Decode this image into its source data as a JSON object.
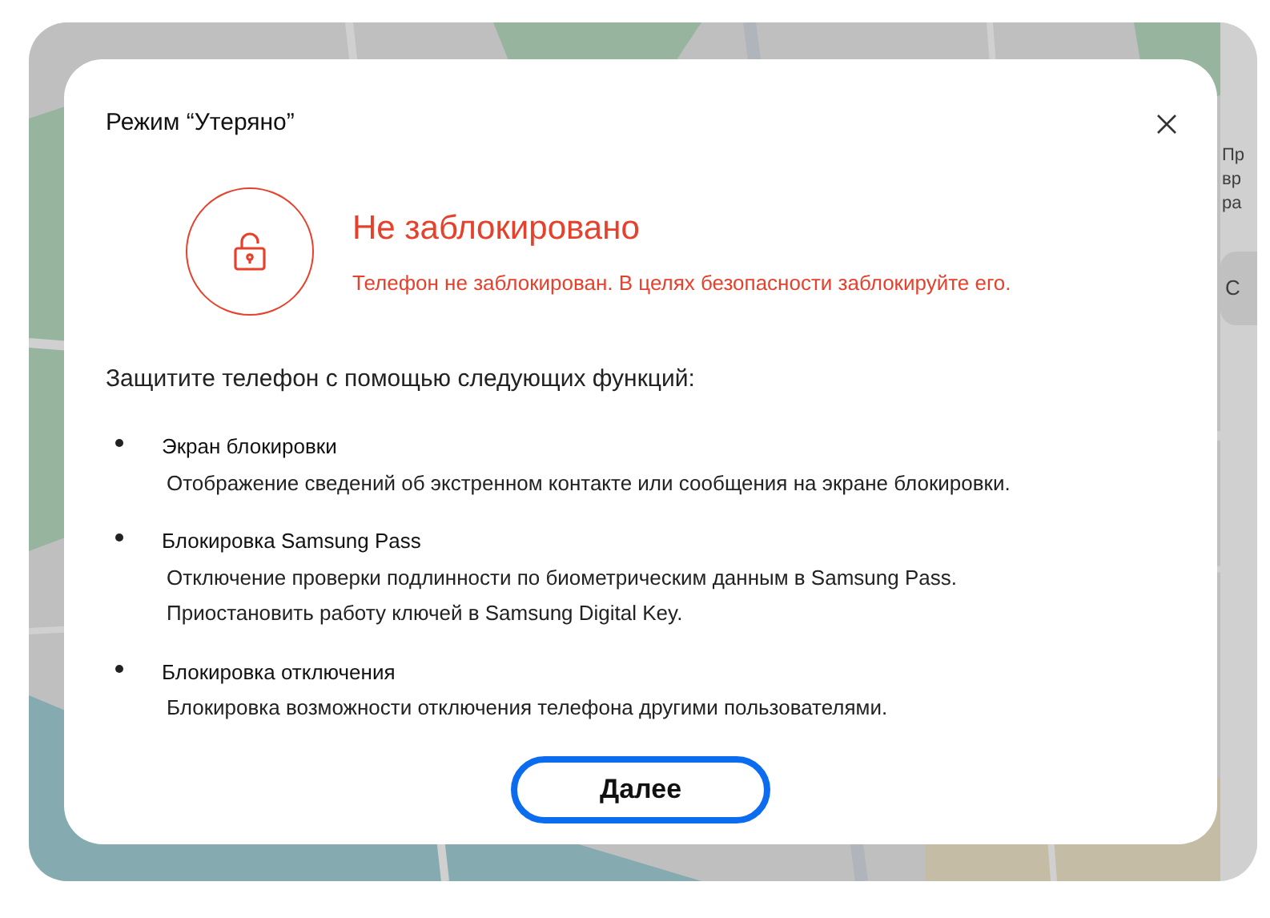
{
  "side_panel": {
    "texts": [
      "Пр",
      "вр",
      "ра"
    ],
    "card_label": "С"
  },
  "dialog": {
    "title": "Режим “Утеряно”",
    "status": {
      "locked": false,
      "heading": "Не заблокировано",
      "message": "Телефон не заблокирован. В целях безопасности заблокируйте его."
    },
    "intro": "Защитите телефон с помощью следующих функций:",
    "features": [
      {
        "title": "Экран блокировки",
        "lines": [
          "Отображение сведений об экстренном контакте или сообщения на экране блокировки."
        ]
      },
      {
        "title": "Блокировка Samsung Pass",
        "lines": [
          "Отключение проверки подлинности по биометрическим данным в Samsung Pass.",
          "Приостановить работу ключей в Samsung Digital Key."
        ]
      },
      {
        "title": "Блокировка отключения",
        "lines": [
          "Блокировка возможности отключения телефона другими пользователями."
        ]
      }
    ],
    "button": "Далее"
  }
}
